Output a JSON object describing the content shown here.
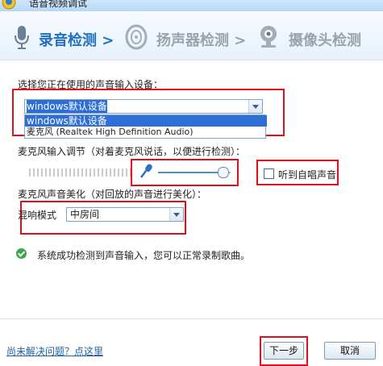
{
  "window": {
    "title": "语音视频调试"
  },
  "steps": [
    {
      "label": "录音检测",
      "separator": ">",
      "state": "active"
    },
    {
      "label": "扬声器检测",
      "separator": ">",
      "state": "inactive"
    },
    {
      "label": "摄像头检测",
      "separator": "",
      "state": "inactive"
    }
  ],
  "input_device": {
    "prompt": "选择您正在使用的声音输入设备：",
    "selected": "windows默认设备",
    "options": [
      "windows默认设备",
      "麦克风 (Realtek High Definition Audio)"
    ]
  },
  "mic_adjust": {
    "label": "麦克风输入调节（对着麦克风说话，以便进行检测）：",
    "volume_fraction": 0.9,
    "monitor_label": "听到自唱声音",
    "monitor_checked": false
  },
  "beautify": {
    "label": "麦克风声音美化（对回放的声音进行美化）：",
    "reverb_label": "混响模式",
    "reverb_selected": "中房间"
  },
  "status": {
    "message": "系统成功检测到声音输入，您可以正常录制歌曲。"
  },
  "footer": {
    "help_link": "尚未解决问题？点这里",
    "next_label": "下一步",
    "cancel_label": "取消"
  },
  "colors": {
    "accent": "#1f6fc2",
    "highlight": "#e0101a",
    "success": "#39a847"
  }
}
